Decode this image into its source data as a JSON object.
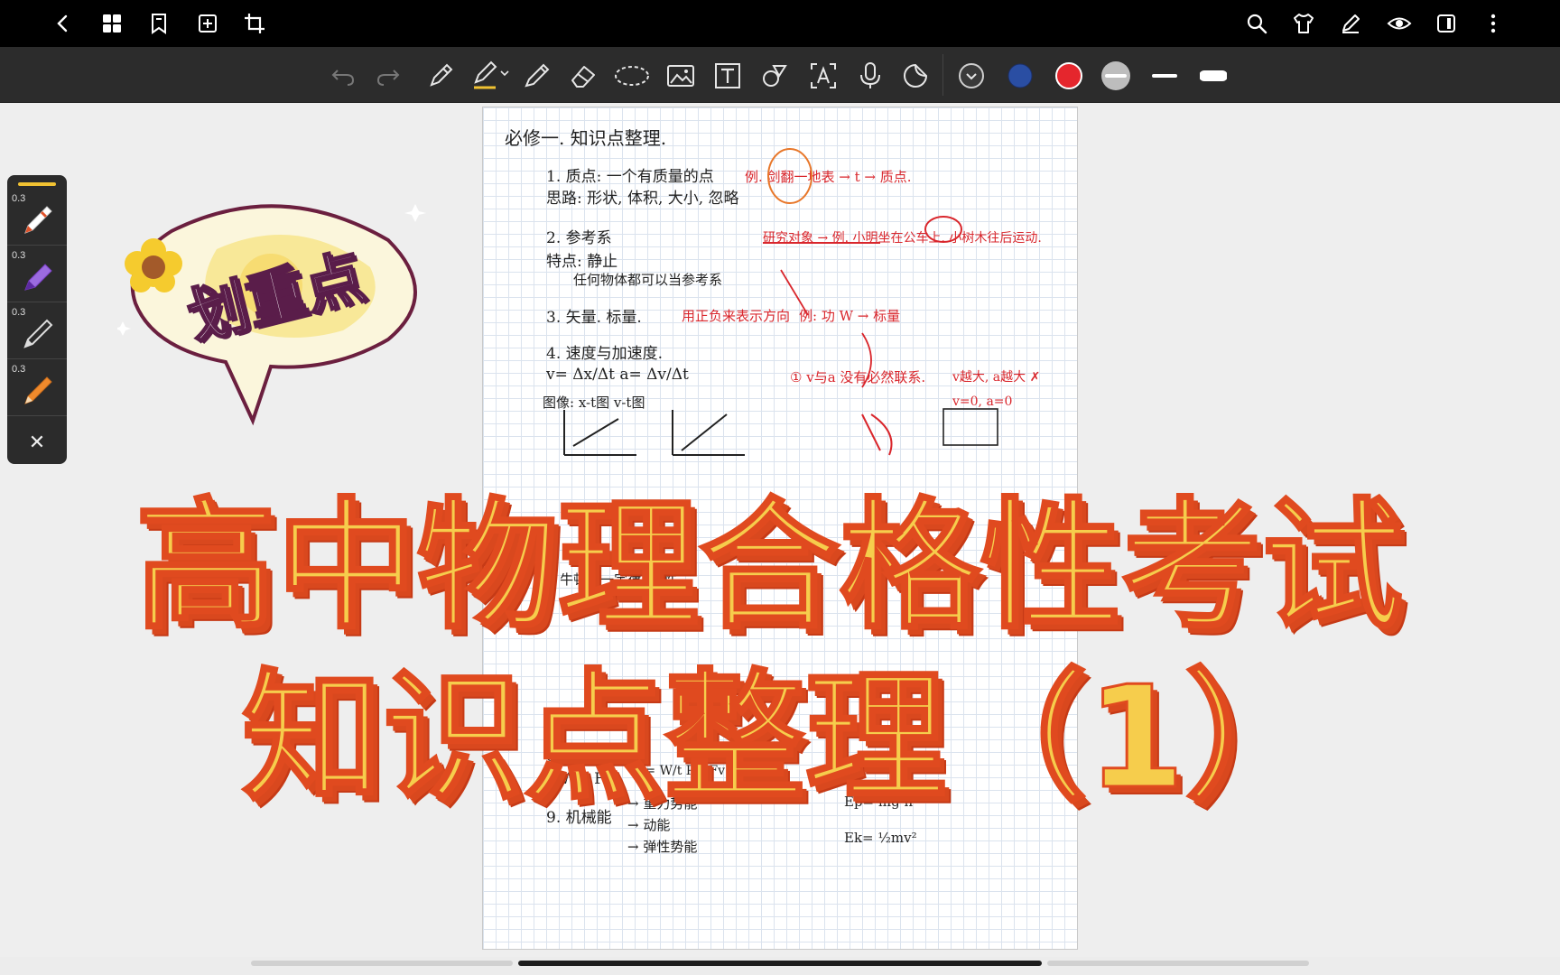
{
  "topbar": {
    "left_icons": [
      "back-icon",
      "grid-icon",
      "bookmark-icon",
      "add-page-icon",
      "crop-icon"
    ],
    "right_icons": [
      "search-icon",
      "shirt-icon",
      "pen-edit-icon",
      "eye-icon",
      "panel-icon",
      "more-icon"
    ]
  },
  "toolbar": {
    "tools": [
      "undo-icon",
      "redo-icon",
      "pen-icon",
      "highlighter-pen-icon",
      "marker-icon",
      "eraser-icon",
      "lasso-icon",
      "image-icon",
      "text-icon",
      "shape-icon",
      "text-recognize-icon",
      "microphone-icon",
      "sticker-icon"
    ],
    "colors": {
      "dropdown": "#3a3a3a",
      "navy": "#2a4ea3",
      "red": "#e5262d",
      "gray": "#bdbdbd"
    },
    "stroke_widths": [
      "thin",
      "thick"
    ]
  },
  "pen_panel": {
    "pens": [
      {
        "size": "0.3",
        "color": "#e0522a"
      },
      {
        "size": "0.3",
        "color": "#7b3fc6"
      },
      {
        "size": "0.3",
        "color": "#dddddd"
      },
      {
        "size": "0.3",
        "color": "#f08a2c"
      }
    ],
    "close_label": "✕",
    "accent": "#f1c232"
  },
  "bubble": {
    "text": "划重点"
  },
  "overlay": {
    "line1": "高中物理合格性考试",
    "line2": "知识点整理（1）"
  },
  "notes": {
    "heading": "必修一. 知识点整理.",
    "lines": [
      {
        "text": "1. 质点: 一个有质量的点",
        "color": "blk"
      },
      {
        "text": "思路: 形状, 体积, 大小, 忽略",
        "color": "blk"
      },
      {
        "text": "例. 剑翻一地表 → t → 质点.",
        "color": "red"
      },
      {
        "text": "2. 参考系",
        "color": "blk"
      },
      {
        "text": "研究对象 → 例. 小明坐在公车上. 小树木往后运动.",
        "color": "red"
      },
      {
        "text": "特点: 静止",
        "color": "blk"
      },
      {
        "text": "任何物体都可以当参考系",
        "color": "blk"
      },
      {
        "text": "3. 矢量. 标量.",
        "color": "blk"
      },
      {
        "text": "用正负来表示方向",
        "color": "red"
      },
      {
        "text": "例: 功 W → 标量",
        "color": "red"
      },
      {
        "text": "4. 速度与加速度.",
        "color": "blk"
      },
      {
        "text": "v= Δx/Δt   a= Δv/Δt",
        "color": "blk"
      },
      {
        "text": "① v与a 没有必然联系.",
        "color": "red"
      },
      {
        "text": "v越大, a越大 ✗",
        "color": "red"
      },
      {
        "text": "图像: x-t图   v-t图",
        "color": "blk"
      },
      {
        "text": "v=0, a=0",
        "color": "red"
      },
      {
        "text": "6. 牛顿第一定律: 惯性",
        "color": "blk"
      },
      {
        "text": "8. 功  功率.",
        "color": "blk"
      },
      {
        "text": "W= F·S",
        "color": "blk"
      },
      {
        "text": "P= W/t   P= Fv → 瞬时",
        "color": "blk"
      },
      {
        "text": "9. 机械能",
        "color": "blk"
      },
      {
        "text": "→ 重力势能",
        "color": "blk"
      },
      {
        "text": "→ 动能",
        "color": "blk"
      },
      {
        "text": "→ 弹性势能",
        "color": "blk"
      },
      {
        "text": "Ep= mg·h",
        "color": "blk"
      },
      {
        "text": "Ek= ½mv²",
        "color": "blk"
      }
    ]
  }
}
